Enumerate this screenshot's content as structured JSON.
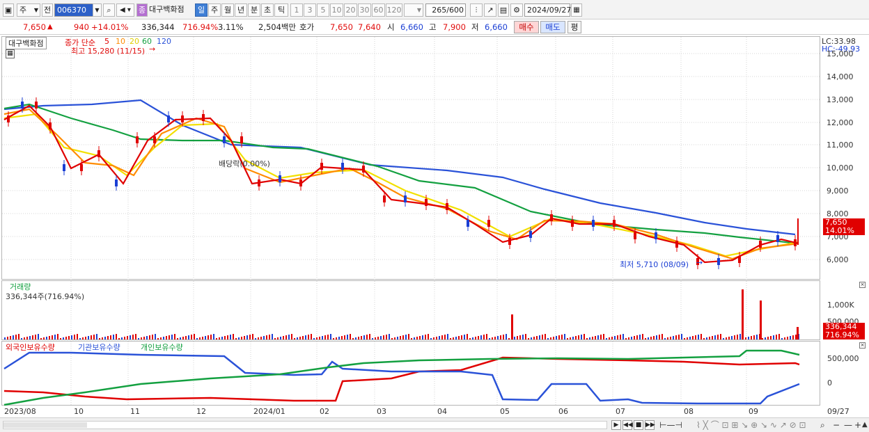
{
  "toolbar": {
    "stock_type": "주",
    "market": "전",
    "code": "006370",
    "stock_icon_label": "종",
    "stock_name": "대구백화점",
    "periods": [
      "일",
      "주",
      "월",
      "년",
      "분",
      "초",
      "틱"
    ],
    "active_period": "일",
    "intervals": [
      "1",
      "3",
      "5",
      "10",
      "20",
      "30",
      "60",
      "120"
    ],
    "count_value": "265",
    "count_total": "/600",
    "date": "2024/09/27"
  },
  "quote": {
    "price": "7,650",
    "change": "940",
    "change_pct": "+14.01%",
    "volume": "336,344",
    "volume_pct": "716.94%",
    "turnover": "3.11%",
    "amount": "2,504백만",
    "hoga_label": "호가",
    "ask": "7,650",
    "bid": "7,640",
    "open_label": "시",
    "open": "6,660",
    "high_label": "고",
    "high": "7,900",
    "low_label": "저",
    "low": "6,660",
    "buy_label": "매수",
    "sell_label": "매도",
    "avg_label": "평"
  },
  "price_pane": {
    "name_tag": "대구백화점",
    "legend_prefix": "종가 단순",
    "ma_labels": [
      "5",
      "10",
      "20",
      "60",
      "120"
    ],
    "ma_colors": [
      "#e00000",
      "#ff8c00",
      "#f2e000",
      "#13a040",
      "#2a52d8"
    ],
    "lc": "LC:33.98",
    "hc": "HC:-49.93",
    "y_ticks": [
      "15,000",
      "14,000",
      "13,000",
      "12,000",
      "11,000",
      "10,000",
      "9,000",
      "8,000",
      "7,000",
      "6,000"
    ],
    "high_note": "최고 15,280 (11/15)",
    "low_note": "최저 5,710 (08/09)",
    "dividend_note": "배당락(0.00%)",
    "last_price_tag": "7,650",
    "last_pct_tag": "14.01%"
  },
  "volume_pane": {
    "title": "거래량",
    "value": "336,344주(716.94%)",
    "y_ticks": [
      "1,000K",
      "500,000"
    ],
    "last_tag": "336,344",
    "last_pct_tag": "716.94%"
  },
  "holdings_pane": {
    "legend": [
      "외국인보유수량",
      "기관보유수량",
      "개인보유수량"
    ],
    "colors": [
      "#e00000",
      "#2a52d8",
      "#13a040"
    ],
    "y_ticks": [
      "500,000",
      "0"
    ]
  },
  "x_axis": [
    "2023/08",
    "10",
    "11",
    "12",
    "2024/01",
    "02",
    "03",
    "04",
    "05",
    "06",
    "07",
    "08",
    "09",
    "09/27"
  ]
}
